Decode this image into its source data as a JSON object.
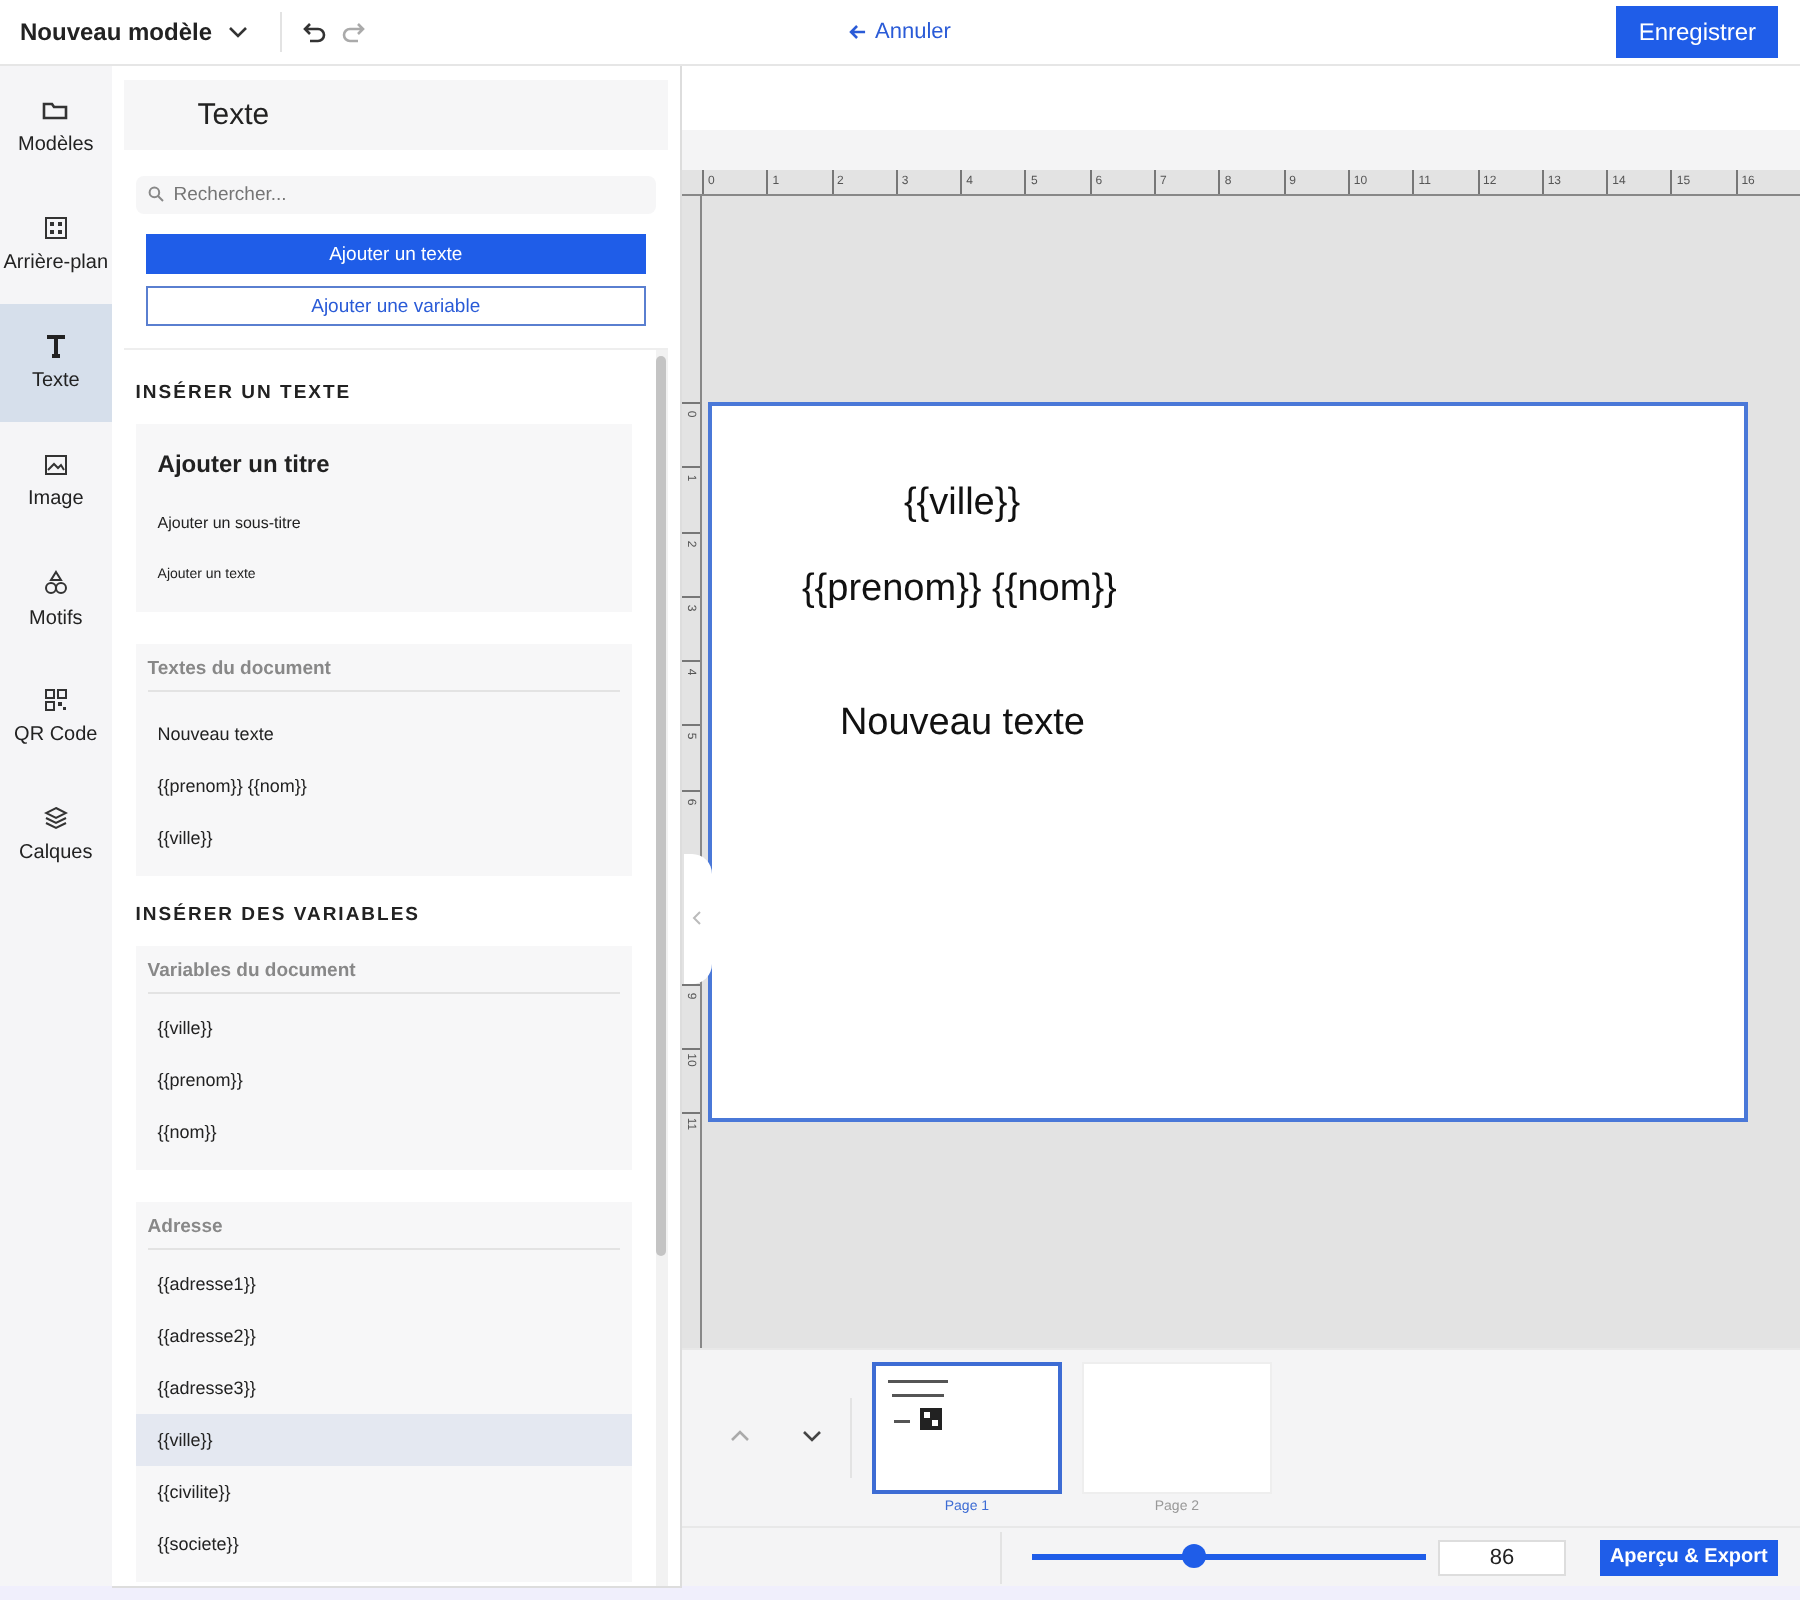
{
  "topbar": {
    "title": "Nouveau modèle",
    "cancel": "Annuler",
    "save": "Enregistrer"
  },
  "rail": [
    {
      "label": "Modèles",
      "selected": false
    },
    {
      "label": "Arrière-plan",
      "selected": false
    },
    {
      "label": "Texte",
      "selected": true
    },
    {
      "label": "Image",
      "selected": false
    },
    {
      "label": "Motifs",
      "selected": false
    },
    {
      "label": "QR Code",
      "selected": false
    },
    {
      "label": "Calques",
      "selected": false
    }
  ],
  "panel": {
    "title": "Texte",
    "search": {
      "placeholder": "Rechercher..."
    },
    "primary_button": "Ajouter un texte",
    "secondary_button": "Ajouter une variable",
    "sections": [
      {
        "heading": "INSÉRER UN TEXTE",
        "groups": [
          {
            "items": [
              {
                "label": "Ajouter un titre",
                "kind": "title",
                "selected": false
              },
              {
                "label": "Ajouter un sous-titre",
                "kind": "subtitle",
                "selected": false
              },
              {
                "label": "Ajouter un texte",
                "kind": "body",
                "selected": false
              }
            ]
          },
          {
            "title": "Textes du document",
            "items": [
              {
                "label": "Nouveau texte",
                "kind": "item",
                "selected": false
              },
              {
                "label": "{{prenom}} {{nom}}",
                "kind": "item",
                "selected": false
              },
              {
                "label": "{{ville}}",
                "kind": "item",
                "selected": false
              }
            ]
          }
        ]
      },
      {
        "heading": "INSÉRER DES VARIABLES",
        "groups": [
          {
            "title": "Variables du document",
            "items": [
              {
                "label": "{{ville}}",
                "kind": "item",
                "selected": false
              },
              {
                "label": "{{prenom}}",
                "kind": "item",
                "selected": false
              },
              {
                "label": "{{nom}}",
                "kind": "item",
                "selected": false
              }
            ]
          },
          {
            "title": "Adresse",
            "items": [
              {
                "label": "{{adresse1}}",
                "kind": "item",
                "selected": false
              },
              {
                "label": "{{adresse2}}",
                "kind": "item",
                "selected": false
              },
              {
                "label": "{{adresse3}}",
                "kind": "item",
                "selected": false
              },
              {
                "label": "{{ville}}",
                "kind": "item",
                "selected": true
              },
              {
                "label": "{{civilite}}",
                "kind": "item",
                "selected": false
              },
              {
                "label": "{{societe}}",
                "kind": "item",
                "selected": false
              }
            ]
          }
        ]
      }
    ]
  },
  "ruler": {
    "horizontal": [
      "0",
      "1",
      "2",
      "3",
      "4",
      "5",
      "6",
      "7",
      "8",
      "9",
      "10",
      "11",
      "12",
      "13",
      "14",
      "15",
      "16"
    ],
    "vertical_before_handle": [
      "0",
      "1",
      "2",
      "3",
      "4",
      "5",
      "6"
    ],
    "vertical_after_handle": [
      "9",
      "10",
      "11"
    ]
  },
  "canvas": {
    "texts": [
      "{{ville}}",
      "{{prenom}} {{nom}}",
      "Nouveau texte"
    ]
  },
  "pages": [
    {
      "label": "Page 1",
      "selected": true,
      "content": true
    },
    {
      "label": "Page 2",
      "selected": false,
      "content": false
    }
  ],
  "zoom": {
    "level": 0.41,
    "value": "86"
  },
  "export_button": "Aperçu & Export"
}
